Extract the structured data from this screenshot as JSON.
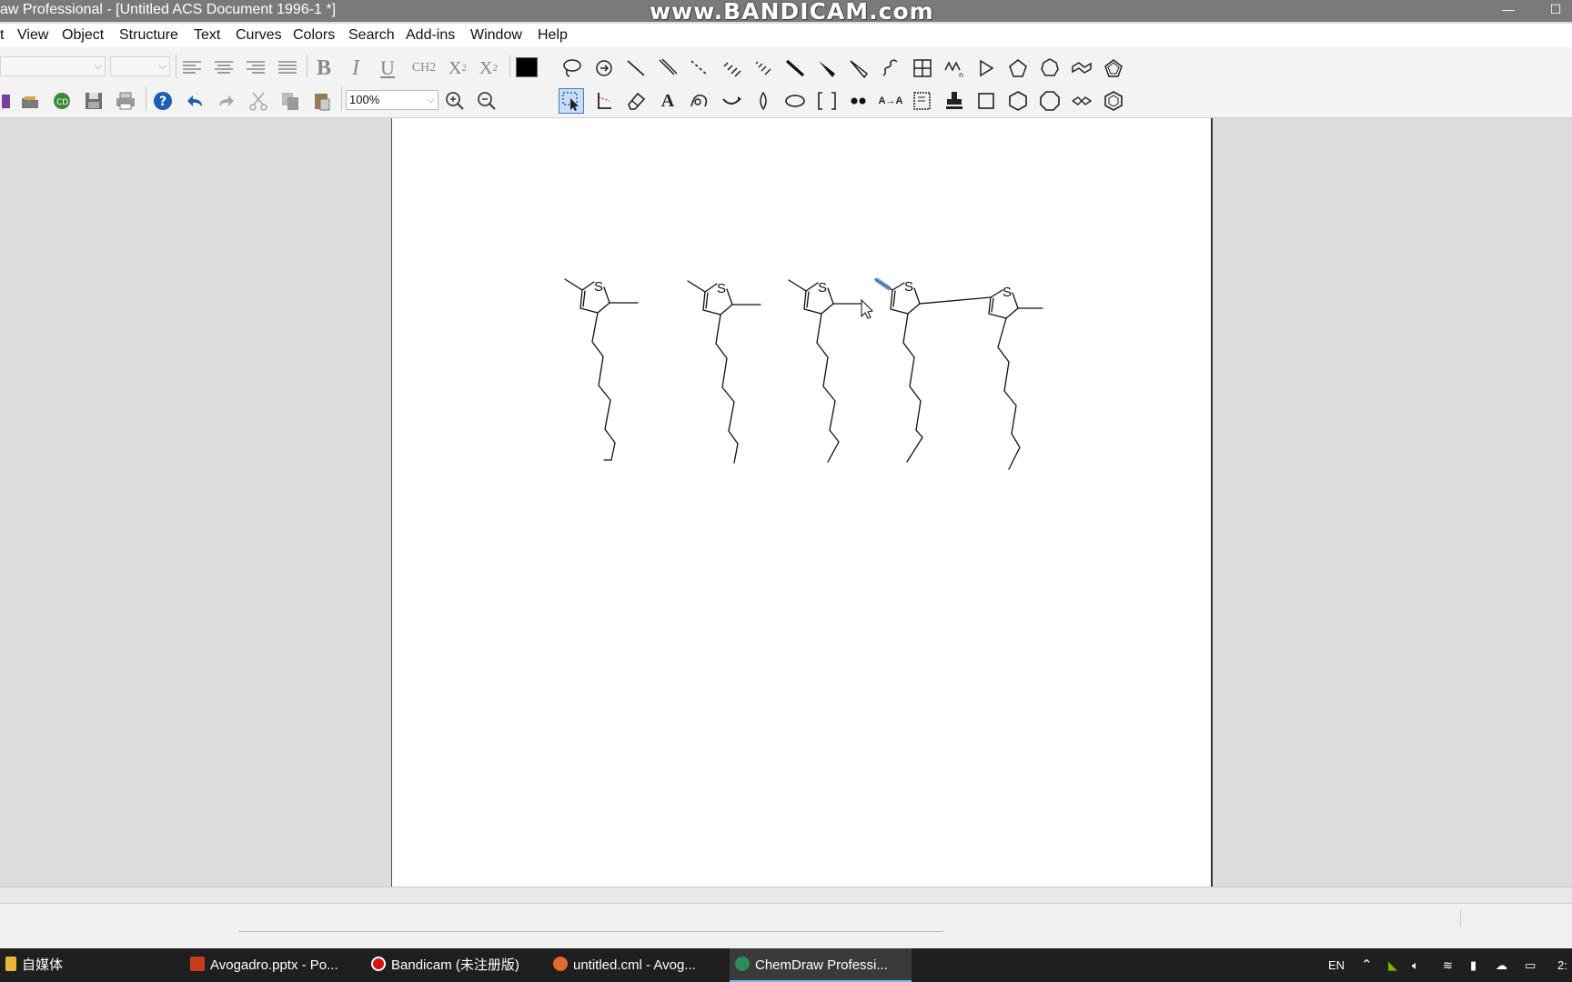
{
  "title_bar": {
    "title": "aw Professional - [Untitled ACS Document 1996-1 *]",
    "watermark": "www.BANDICAM.com"
  },
  "menu": [
    "t",
    "View",
    "Object",
    "Structure",
    "Text",
    "Curves",
    "Colors",
    "Search",
    "Add-ins",
    "Window",
    "Help"
  ],
  "toolbar": {
    "zoom_value": "100%",
    "subscript_label": "CH2",
    "sub_label": "X2",
    "sup_label": "X2",
    "color_value": "#000000",
    "bold_label": "B",
    "italic_label": "I",
    "underline_label": "U",
    "text_tool_label": "A"
  },
  "document": {
    "atom_label": "S",
    "molecules": [
      "thiophene-hexyl-1",
      "thiophene-hexyl-2",
      "thiophene-hexyl-3",
      "bithiophene-hexyl-dimer"
    ]
  },
  "taskbar": {
    "items": [
      {
        "label": "自媒体",
        "icon": "folder-icon"
      },
      {
        "label": "Avogadro.pptx - Po...",
        "icon": "powerpoint-icon"
      },
      {
        "label": "Bandicam (未注册版)",
        "icon": "record-icon"
      },
      {
        "label": "untitled.cml - Avog...",
        "icon": "avogadro-icon"
      },
      {
        "label": "ChemDraw Professi...",
        "icon": "chemdraw-icon"
      }
    ],
    "tray_lang": "EN",
    "clock": "2:"
  },
  "colors": {
    "title_bg": "#7a7a7a",
    "taskbar_bg": "#1f1f1f",
    "selection_blue": "#3d7dc4"
  }
}
